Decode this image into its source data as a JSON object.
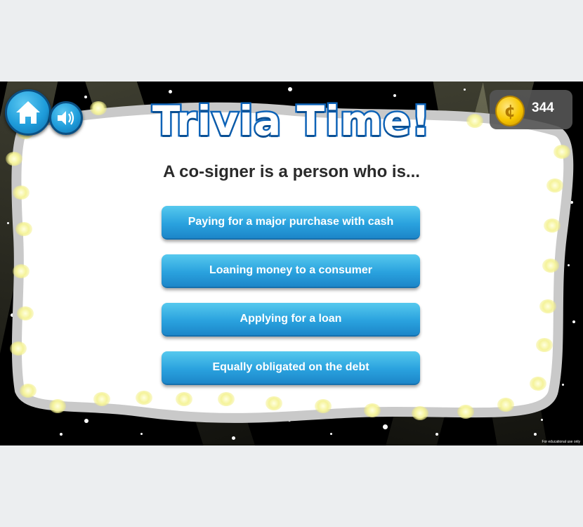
{
  "header": {
    "title": "Trivia Time!",
    "home_icon": "home-icon",
    "sound_icon": "speaker-icon",
    "coins": "344",
    "coin_symbol": "¢"
  },
  "question": "A co-signer is a person who is...",
  "answers": [
    "Paying for a major purchase with cash",
    "Loaning money to a consumer",
    "Applying for a loan",
    "Equally obligated on the debt"
  ],
  "footer_note": "For educational use only",
  "colors": {
    "title_outline": "#0d63b8",
    "button_blue": "#2aa2de",
    "coin_gold": "#f7c600",
    "background": "#000000",
    "card": "#ffffff"
  }
}
